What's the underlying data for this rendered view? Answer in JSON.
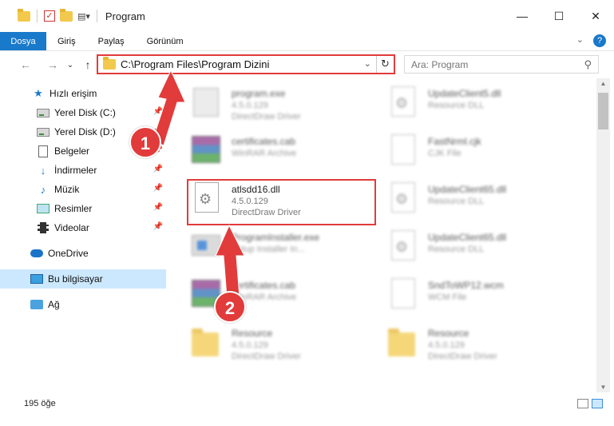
{
  "window": {
    "title": "Program",
    "minimize": "—",
    "maximize": "☐",
    "close": "✕"
  },
  "ribbon": {
    "tabs": [
      "Dosya",
      "Giriş",
      "Paylaş",
      "Görünüm"
    ],
    "expand": "⌄",
    "help": "?"
  },
  "nav": {
    "back": "←",
    "forward": "→",
    "recent": "⌄",
    "up": "↑",
    "address": "C:\\Program Files\\Program Dizini",
    "address_dropdown": "⌄",
    "refresh": "↻",
    "search_placeholder": "Ara: Program",
    "search_icon": "⚲"
  },
  "sidebar": {
    "items": [
      {
        "label": "Hızlı erişim",
        "icon": "star-icon",
        "pinned": false
      },
      {
        "label": "Yerel Disk (C:)",
        "icon": "drive-icon",
        "pinned": true
      },
      {
        "label": "Yerel Disk (D:)",
        "icon": "drive-icon",
        "pinned": true
      },
      {
        "label": "Belgeler",
        "icon": "documents-icon",
        "pinned": true
      },
      {
        "label": "İndirmeler",
        "icon": "download-icon",
        "pinned": true
      },
      {
        "label": "Müzik",
        "icon": "music-icon",
        "pinned": true
      },
      {
        "label": "Resimler",
        "icon": "pictures-icon",
        "pinned": true
      },
      {
        "label": "Videolar",
        "icon": "videos-icon",
        "pinned": true
      },
      {
        "label": "OneDrive",
        "icon": "cloud-icon",
        "pinned": false
      },
      {
        "label": "Bu bilgisayar",
        "icon": "computer-icon",
        "pinned": false,
        "selected": true
      },
      {
        "label": "Ağ",
        "icon": "network-icon",
        "pinned": false
      }
    ],
    "pin_glyph": "📌"
  },
  "files": {
    "left": [
      {
        "name": "program.exe",
        "line2": "4.5.0.129",
        "line3": "DirectDraw Driver",
        "kind": "exe",
        "blurred": true
      },
      {
        "name": "certificates.cab",
        "line2": "WinRAR Archive",
        "line3": "",
        "kind": "rar",
        "blurred": true
      },
      {
        "name": "atlsdd16.dll",
        "line2": "4.5.0.129",
        "line3": "DirectDraw Driver",
        "kind": "dll",
        "blurred": false
      },
      {
        "name": "ProgramInstaller.exe",
        "line2": "Setup Installer In...",
        "line3": "",
        "kind": "installer",
        "blurred": true
      },
      {
        "name": "certificates.cab",
        "line2": "WinRAR Archive",
        "line3": "",
        "kind": "rar",
        "blurred": true
      },
      {
        "name": "Resource",
        "line2": "4.5.0.129",
        "line3": "DirectDraw Driver",
        "kind": "folder",
        "blurred": true
      }
    ],
    "right": [
      {
        "name": "UpdateClient5.dll",
        "line2": "Resource DLL",
        "line3": "",
        "kind": "dll",
        "blurred": true
      },
      {
        "name": "FastNrml.cjk",
        "line2": "CJK File",
        "line3": "",
        "kind": "file",
        "blurred": true
      },
      {
        "name": "UpdateClient65.dll",
        "line2": "Resource DLL",
        "line3": "",
        "kind": "dll",
        "blurred": true
      },
      {
        "name": "UpdateClient65.dll",
        "line2": "Resource DLL",
        "line3": "",
        "kind": "dll",
        "blurred": true
      },
      {
        "name": "SndToWP12.wcm",
        "line2": "WCM File",
        "line3": "",
        "kind": "file",
        "blurred": true
      },
      {
        "name": "Resource",
        "line2": "4.5.0.129",
        "line3": "DirectDraw Driver",
        "kind": "folder",
        "blurred": true
      }
    ]
  },
  "annotations": {
    "step1": "1",
    "step2": "2",
    "color": "#e23b3b"
  },
  "status": {
    "count": "195 öğe"
  },
  "colors": {
    "accent": "#1979ca",
    "selected": "#cce8ff"
  }
}
